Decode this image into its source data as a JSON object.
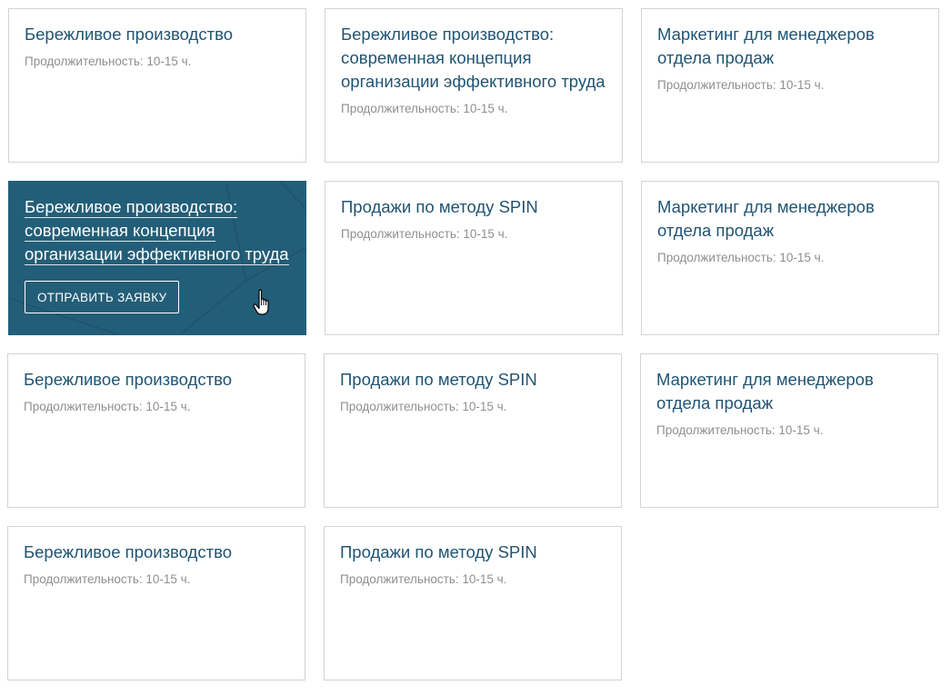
{
  "courses": [
    {
      "title": "Бережливое производство",
      "duration": "Продолжительность: 10-15 ч."
    },
    {
      "title": "Бережливое производство: современная концепция организации эффективного труда",
      "duration": "Продолжительность: 10-15 ч."
    },
    {
      "title": "Маркетинг для менеджеров отдела продаж",
      "duration": "Продолжительность: 10-15 ч."
    },
    {
      "title": "Бережливое производство: современная концепция организации эффективного труда",
      "button": "ОТПРАВИТЬ ЗАЯВКУ"
    },
    {
      "title": "Продажи по методу SPIN",
      "duration": "Продолжительность: 10-15 ч."
    },
    {
      "title": "Маркетинг для менеджеров отдела продаж",
      "duration": "Продолжительность: 10-15 ч."
    },
    {
      "title": "Бережливое производство",
      "duration": "Продолжительность: 10-15 ч."
    },
    {
      "title": "Продажи по методу SPIN",
      "duration": "Продолжительность: 10-15 ч."
    },
    {
      "title": "Маркетинг для менеджеров отдела продаж",
      "duration": "Продолжительность: 10-15 ч."
    },
    {
      "title": "Бережливое производство",
      "duration": "Продолжительность: 10-15 ч."
    },
    {
      "title": "Продажи по методу SPIN",
      "duration": "Продолжительность: 10-15 ч."
    }
  ],
  "colors": {
    "title": "#1f5474",
    "duration": "#8f8f8f",
    "active_bg": "#235e78",
    "border": "#d3d3d3"
  },
  "icons": {
    "cursor": "hand-pointer-icon"
  }
}
